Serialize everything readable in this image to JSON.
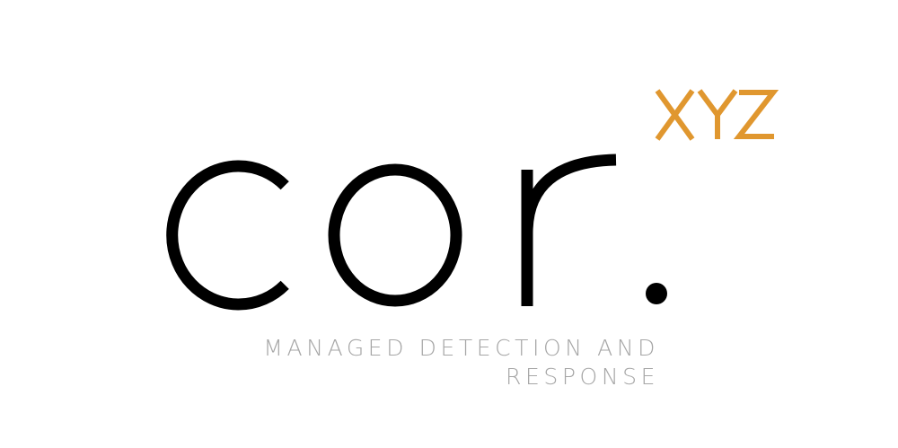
{
  "logo": {
    "wordmark": "cor.",
    "superscript": "XYZ",
    "tagline_line1": "MANAGED DETECTION AND",
    "tagline_line2": "RESPONSE"
  },
  "colors": {
    "background": "#ffffff",
    "wordmark": "#000000",
    "superscript": "#e0972f",
    "tagline": "#a6a6a6"
  }
}
